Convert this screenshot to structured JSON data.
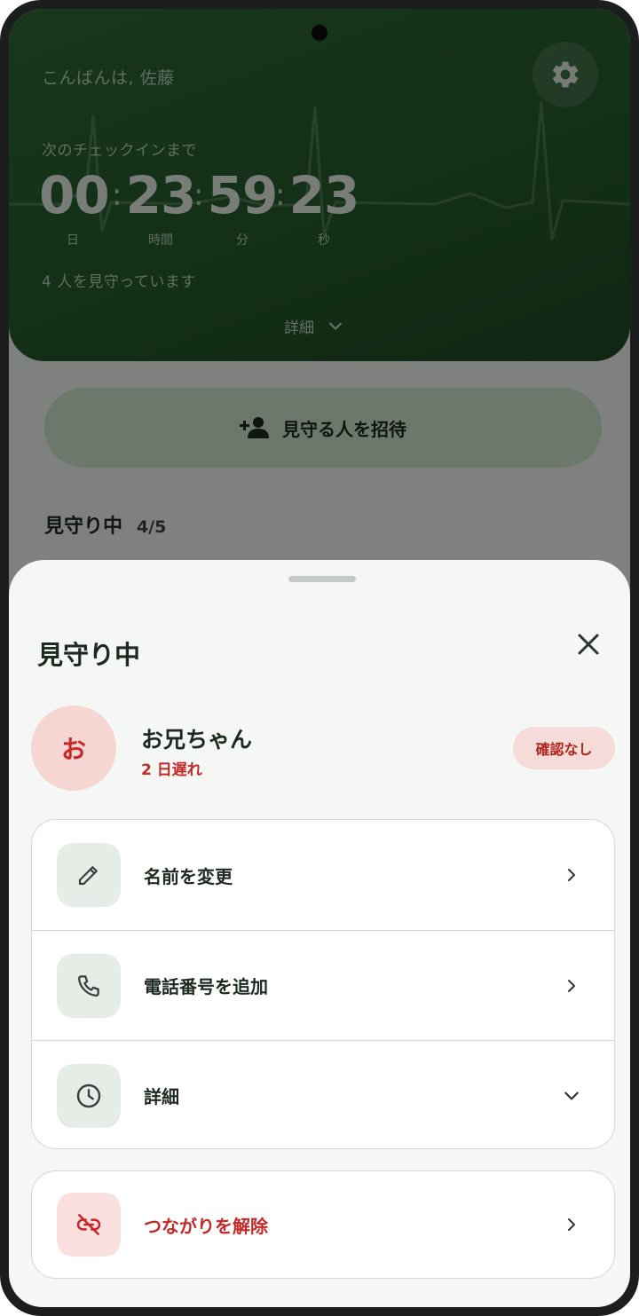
{
  "header": {
    "greeting": "こんばんは, 佐藤",
    "next_checkin_label": "次のチェックインまで",
    "countdown": {
      "days": "00",
      "hours": "23",
      "minutes": "59",
      "seconds": "23",
      "days_label": "日",
      "hours_label": "時間",
      "minutes_label": "分",
      "seconds_label": "秒",
      "separator": ":"
    },
    "watching_text": "4 人を見守っています",
    "details_label": "詳細",
    "settings_icon": "gear-icon"
  },
  "main": {
    "invite_label": "見守る人を招待",
    "section_title": "見守り中",
    "section_count": "4/5"
  },
  "sheet": {
    "title": "見守り中",
    "person": {
      "avatar_initial": "お",
      "name": "お兄ちゃん",
      "status": "2 日遅れ",
      "badge": "確認なし"
    },
    "actions": [
      {
        "label": "名前を変更",
        "icon": "pencil-icon"
      },
      {
        "label": "電話番号を追加",
        "icon": "phone-icon"
      },
      {
        "label": "詳細",
        "icon": "clock-icon"
      }
    ],
    "danger_action": {
      "label": "つながりを解除",
      "icon": "link-off-icon"
    }
  },
  "colors": {
    "header_green": "#2f6a37",
    "invite_bg": "#cfe6d0",
    "danger_red": "#c62828",
    "badge_bg": "#f5dcd9",
    "sheet_bg": "#f4f7f4"
  }
}
